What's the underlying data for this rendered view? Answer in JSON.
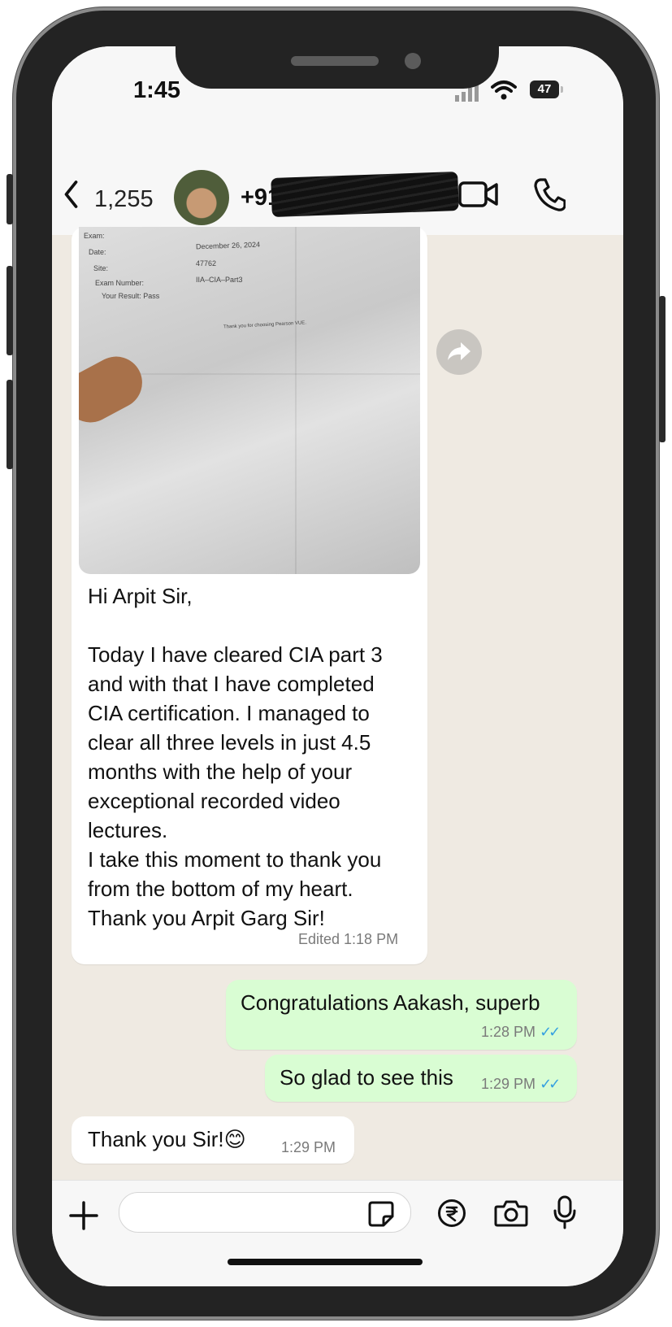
{
  "status_bar": {
    "time": "1:45",
    "battery": "47"
  },
  "header": {
    "back_count": "1,255",
    "contact_visible": "+91"
  },
  "photo_doc": {
    "exam_label": "Exam:",
    "date_label": "Date:",
    "date_value": "December 26, 2024",
    "site_label": "Site:",
    "site_value": "47762",
    "exam_number_label": "Exam Number:",
    "exam_number_value": "IIA–CIA–Part3",
    "result": "Your Result: Pass",
    "thanks": "Thank you for choosing Pearson VUE."
  },
  "messages": [
    {
      "direction": "incoming",
      "text": "Hi Arpit Sir,\n\nToday I have cleared CIA part 3\nand with that I have completed\nCIA certification. I managed to\nclear all three levels in just 4.5\nmonths with the help of your\nexceptional recorded video\nlectures.\nI take this moment to thank you\nfrom the bottom of my heart.\nThank you Arpit Garg Sir!",
      "meta": "Edited 1:18 PM"
    },
    {
      "direction": "outgoing",
      "text": "Congratulations Aakash, superb",
      "meta": "1:28 PM"
    },
    {
      "direction": "outgoing",
      "text": "So glad to see this",
      "meta": "1:29 PM"
    },
    {
      "direction": "incoming",
      "text": "Thank you Sir!😊",
      "meta": "1:29 PM"
    }
  ],
  "colors": {
    "incoming_bubble": "#ffffff",
    "outgoing_bubble": "#d9fdd3",
    "chat_bg": "#efeae2",
    "read_ticks": "#35a0e0"
  }
}
